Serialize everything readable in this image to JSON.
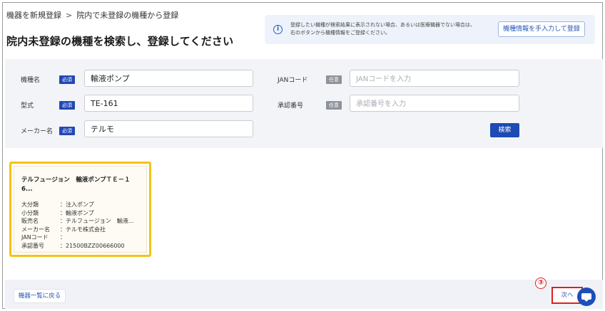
{
  "breadcrumb": {
    "parent": "機器を新規登録",
    "separator": ">",
    "current": "院内で未登録の機種から登録"
  },
  "page_title": "院内未登録の機種を検索し、登録してください",
  "info": {
    "icon": "info-icon",
    "line1": "登録したい機種が検索結果に表示されない場合、あるいは医療機器でない場合は、",
    "line2": "右のボタンから機種情報をご登録ください。",
    "manual_button": "機種情報を手入力して登録"
  },
  "search": {
    "required_badge": "必須",
    "optional_badge": "任意",
    "fields": {
      "name": {
        "label": "機種名",
        "value": "輸液ポンプ"
      },
      "model": {
        "label": "型式",
        "value": "TE-161"
      },
      "maker": {
        "label": "メーカー名",
        "value": "テルモ"
      },
      "jan": {
        "label": "JANコード",
        "value": "",
        "placeholder": "JANコードを入力"
      },
      "approval": {
        "label": "承認番号",
        "value": "",
        "placeholder": "承認番号を入力"
      }
    },
    "search_button": "検索"
  },
  "results": [
    {
      "title_line1": "テルフュージョン　輸液ポンプＴＥ－１",
      "title_line2": "6...",
      "rows": [
        {
          "key": "大分類",
          "value": "：注入ポンプ"
        },
        {
          "key": "小分類",
          "value": "：輸液ポンプ"
        },
        {
          "key": "販売名",
          "value": "：テルフュージョン　輸液..."
        },
        {
          "key": "メーカー名",
          "value": "：テルモ株式会社"
        },
        {
          "key": "JANコード",
          "value": "："
        },
        {
          "key": "承認番号",
          "value": "：21500BZZ00666000"
        }
      ]
    }
  ],
  "footer": {
    "back_link": "機器一覧に戻る",
    "next_button": "次へ",
    "step_marker": "③",
    "chat_icon": "chat-bubble-icon"
  },
  "colors": {
    "primary": "#1d4ab3",
    "highlight": "#f5c218",
    "annotation": "#e02020"
  }
}
